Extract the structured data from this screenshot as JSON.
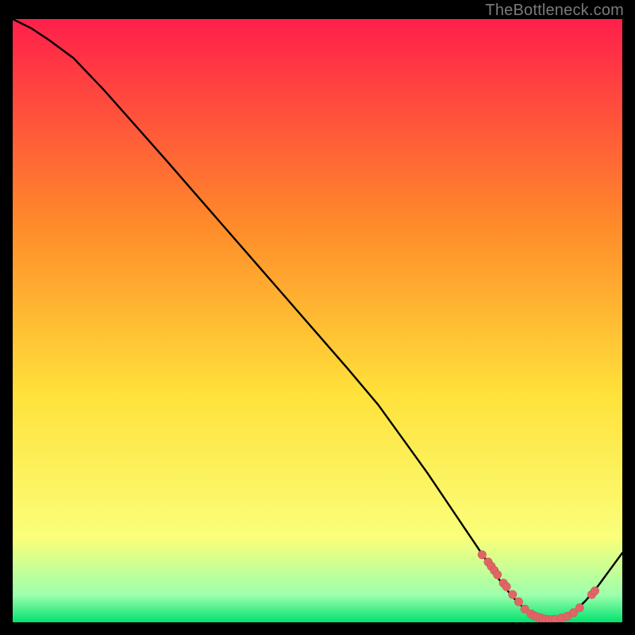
{
  "watermark": "TheBottleneck.com",
  "colors": {
    "bg": "#000000",
    "curve": "#000000",
    "dot_fill": "#e06666",
    "dot_stroke": "#d35454",
    "grad_top": "#ff1f4b",
    "grad_mid1": "#ff8a2a",
    "grad_mid2": "#ffe13a",
    "grad_low1": "#faff7a",
    "grad_low2": "#9dffad",
    "grad_bottom": "#00e36e"
  },
  "chart_data": {
    "type": "line",
    "title": "",
    "xlabel": "",
    "ylabel": "",
    "xlim": [
      0,
      100
    ],
    "ylim": [
      0,
      100
    ],
    "grid": false,
    "legend": false,
    "series": [
      {
        "name": "bottleneck-curve",
        "x": [
          0,
          3,
          6,
          10,
          15,
          20,
          25,
          30,
          35,
          40,
          45,
          50,
          55,
          60,
          62,
          65,
          68,
          70,
          72,
          74,
          76,
          78,
          80,
          82,
          84,
          86,
          88,
          90,
          92,
          94,
          96,
          100
        ],
        "y": [
          100,
          98.5,
          96.5,
          93.5,
          88.2,
          82.5,
          76.8,
          71,
          65.2,
          59.4,
          53.6,
          47.8,
          42,
          36,
          33.2,
          29,
          24.8,
          21.8,
          18.8,
          15.8,
          12.8,
          9.8,
          6.8,
          4.2,
          2.2,
          1,
          0.4,
          0.6,
          1.6,
          3.6,
          6,
          11.5
        ]
      }
    ],
    "annotations": {
      "dots": [
        {
          "x": 77,
          "y": 11.2
        },
        {
          "x": 78,
          "y": 10.0
        },
        {
          "x": 78.5,
          "y": 9.3
        },
        {
          "x": 79,
          "y": 8.6
        },
        {
          "x": 79.5,
          "y": 7.9
        },
        {
          "x": 80.5,
          "y": 6.5
        },
        {
          "x": 81,
          "y": 5.9
        },
        {
          "x": 82,
          "y": 4.6
        },
        {
          "x": 83,
          "y": 3.4
        },
        {
          "x": 84,
          "y": 2.2
        },
        {
          "x": 85,
          "y": 1.4
        },
        {
          "x": 85.5,
          "y": 1.1
        },
        {
          "x": 86,
          "y": 0.9
        },
        {
          "x": 86.5,
          "y": 0.75
        },
        {
          "x": 87,
          "y": 0.6
        },
        {
          "x": 87.5,
          "y": 0.5
        },
        {
          "x": 88,
          "y": 0.45
        },
        {
          "x": 88.5,
          "y": 0.45
        },
        {
          "x": 89,
          "y": 0.5
        },
        {
          "x": 90,
          "y": 0.7
        },
        {
          "x": 91,
          "y": 1.0
        },
        {
          "x": 92,
          "y": 1.6
        },
        {
          "x": 93,
          "y": 2.4
        },
        {
          "x": 95,
          "y": 4.6
        },
        {
          "x": 95.5,
          "y": 5.2
        }
      ]
    }
  }
}
